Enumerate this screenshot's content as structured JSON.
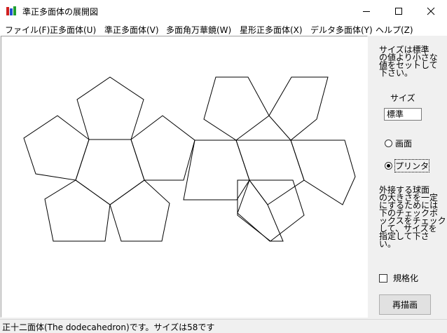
{
  "window": {
    "title": "準正多面体の展開図"
  },
  "menu": [
    "ファイル(F)",
    "正多面体(U)",
    "準正多面体(V)",
    "多面角万華鏡(W)",
    "星形正多面体(X)",
    "デルタ多面体(Y)",
    "ヘルプ(Z)"
  ],
  "panel": {
    "instruction_lines": [
      "サイズは標準",
      "の値より小さな",
      "値をセットして",
      "下さい。"
    ],
    "size_label": "サイズ",
    "size_value": "標準",
    "radio_screen": "画面",
    "radio_printer": "プリンタ",
    "selected_output": "プリンタ",
    "note_lines": [
      "外接する球面",
      "の大きさを一定",
      "にするためには",
      "下のチェックボ",
      "ックスをチェック",
      "して、サイズを",
      "指定して下さ",
      "い。"
    ],
    "normalize_label": "規格化",
    "normalize_checked": false,
    "redraw_button": "再描画"
  },
  "status": {
    "text": "正十二面体(The dodecahedron)です。サイズは58です"
  }
}
